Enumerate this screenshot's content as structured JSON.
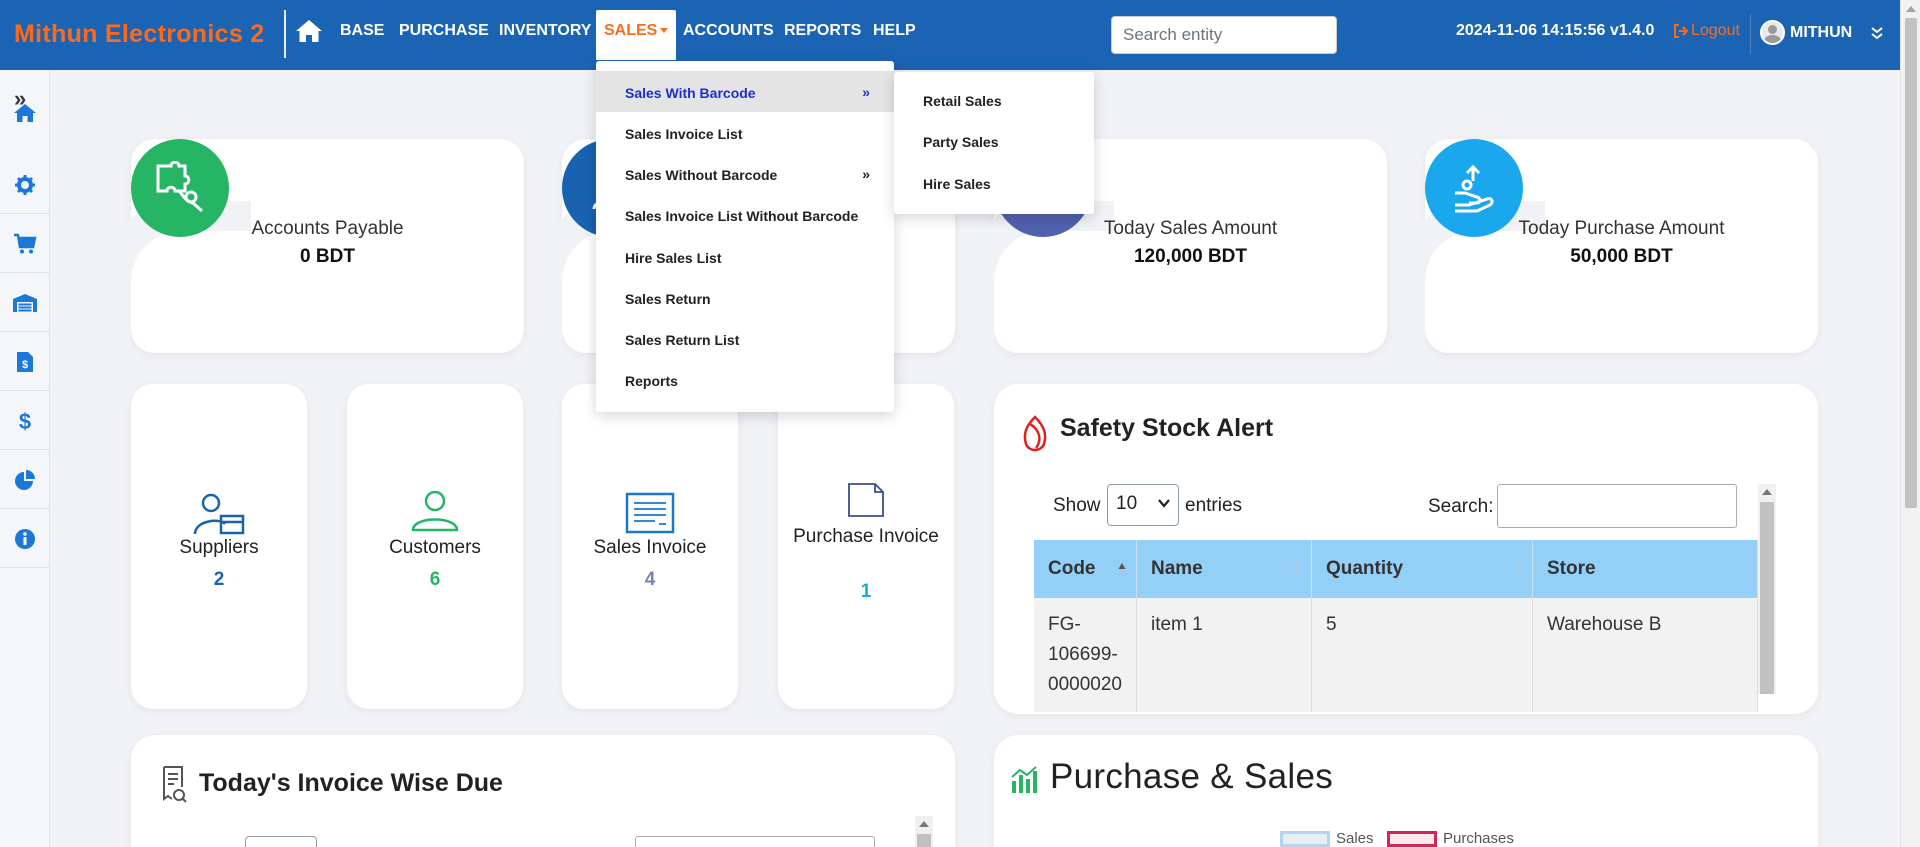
{
  "brand": "Mithun Electronics 2",
  "nav": {
    "items": [
      "BASE",
      "PURCHASE",
      "INVENTORY",
      "SALES",
      "ACCOUNTS",
      "REPORTS",
      "HELP"
    ],
    "search_placeholder": "Search entity",
    "datetime": "2024-11-06 14:15:56 v1.4.0",
    "logout": "Logout",
    "user": "MITHUN"
  },
  "sales_menu": {
    "items": [
      {
        "label": "Sales With Barcode",
        "has_sub": true
      },
      {
        "label": "Sales Invoice List"
      },
      {
        "label": "Sales Without Barcode",
        "has_sub": true
      },
      {
        "label": "Sales Invoice List Without Barcode"
      },
      {
        "label": "Hire Sales List"
      },
      {
        "label": "Sales Return"
      },
      {
        "label": "Sales Return List"
      },
      {
        "label": "Reports"
      }
    ],
    "submenu": [
      "Retail Sales",
      "Party Sales",
      "Hire Sales"
    ],
    "arrow": "»"
  },
  "summary_cards": [
    {
      "label": "Accounts Payable",
      "value": "0 BDT",
      "color": "#25b564"
    },
    {
      "label": "Today Sales Amount",
      "value": "120,000 BDT",
      "color": "#5161ad"
    },
    {
      "label": "Today Purchase Amount",
      "value": "50,000 BDT",
      "color": "#1ba7ee"
    }
  ],
  "count_cards": [
    {
      "label": "Suppliers",
      "value": "2",
      "color": "#1862b0"
    },
    {
      "label": "Customers",
      "value": "6",
      "color": "#25b564"
    },
    {
      "label": "Sales Invoice",
      "value": "4",
      "color": "#7a83b8"
    },
    {
      "label": "Purchase Invoice",
      "value": "1",
      "color": "#1ba7ee"
    }
  ],
  "safety_stock": {
    "title": "Safety Stock Alert",
    "show": "Show",
    "entries_value": "10",
    "entries": "entries",
    "search_label": "Search:",
    "columns": [
      "Code",
      "Name",
      "Quantity",
      "Store"
    ],
    "rows": [
      {
        "code": "FG-\n106699-\n0000020",
        "name": "item 1",
        "quantity": "5",
        "store": "Warehouse B"
      }
    ]
  },
  "invoice_due": {
    "title": "Today's Invoice Wise Due"
  },
  "purchase_sales": {
    "title": "Purchase & Sales",
    "legend": [
      {
        "name": "Sales",
        "color": "#add8f0"
      },
      {
        "name": "Purchases",
        "color": "#d0285a"
      }
    ]
  }
}
